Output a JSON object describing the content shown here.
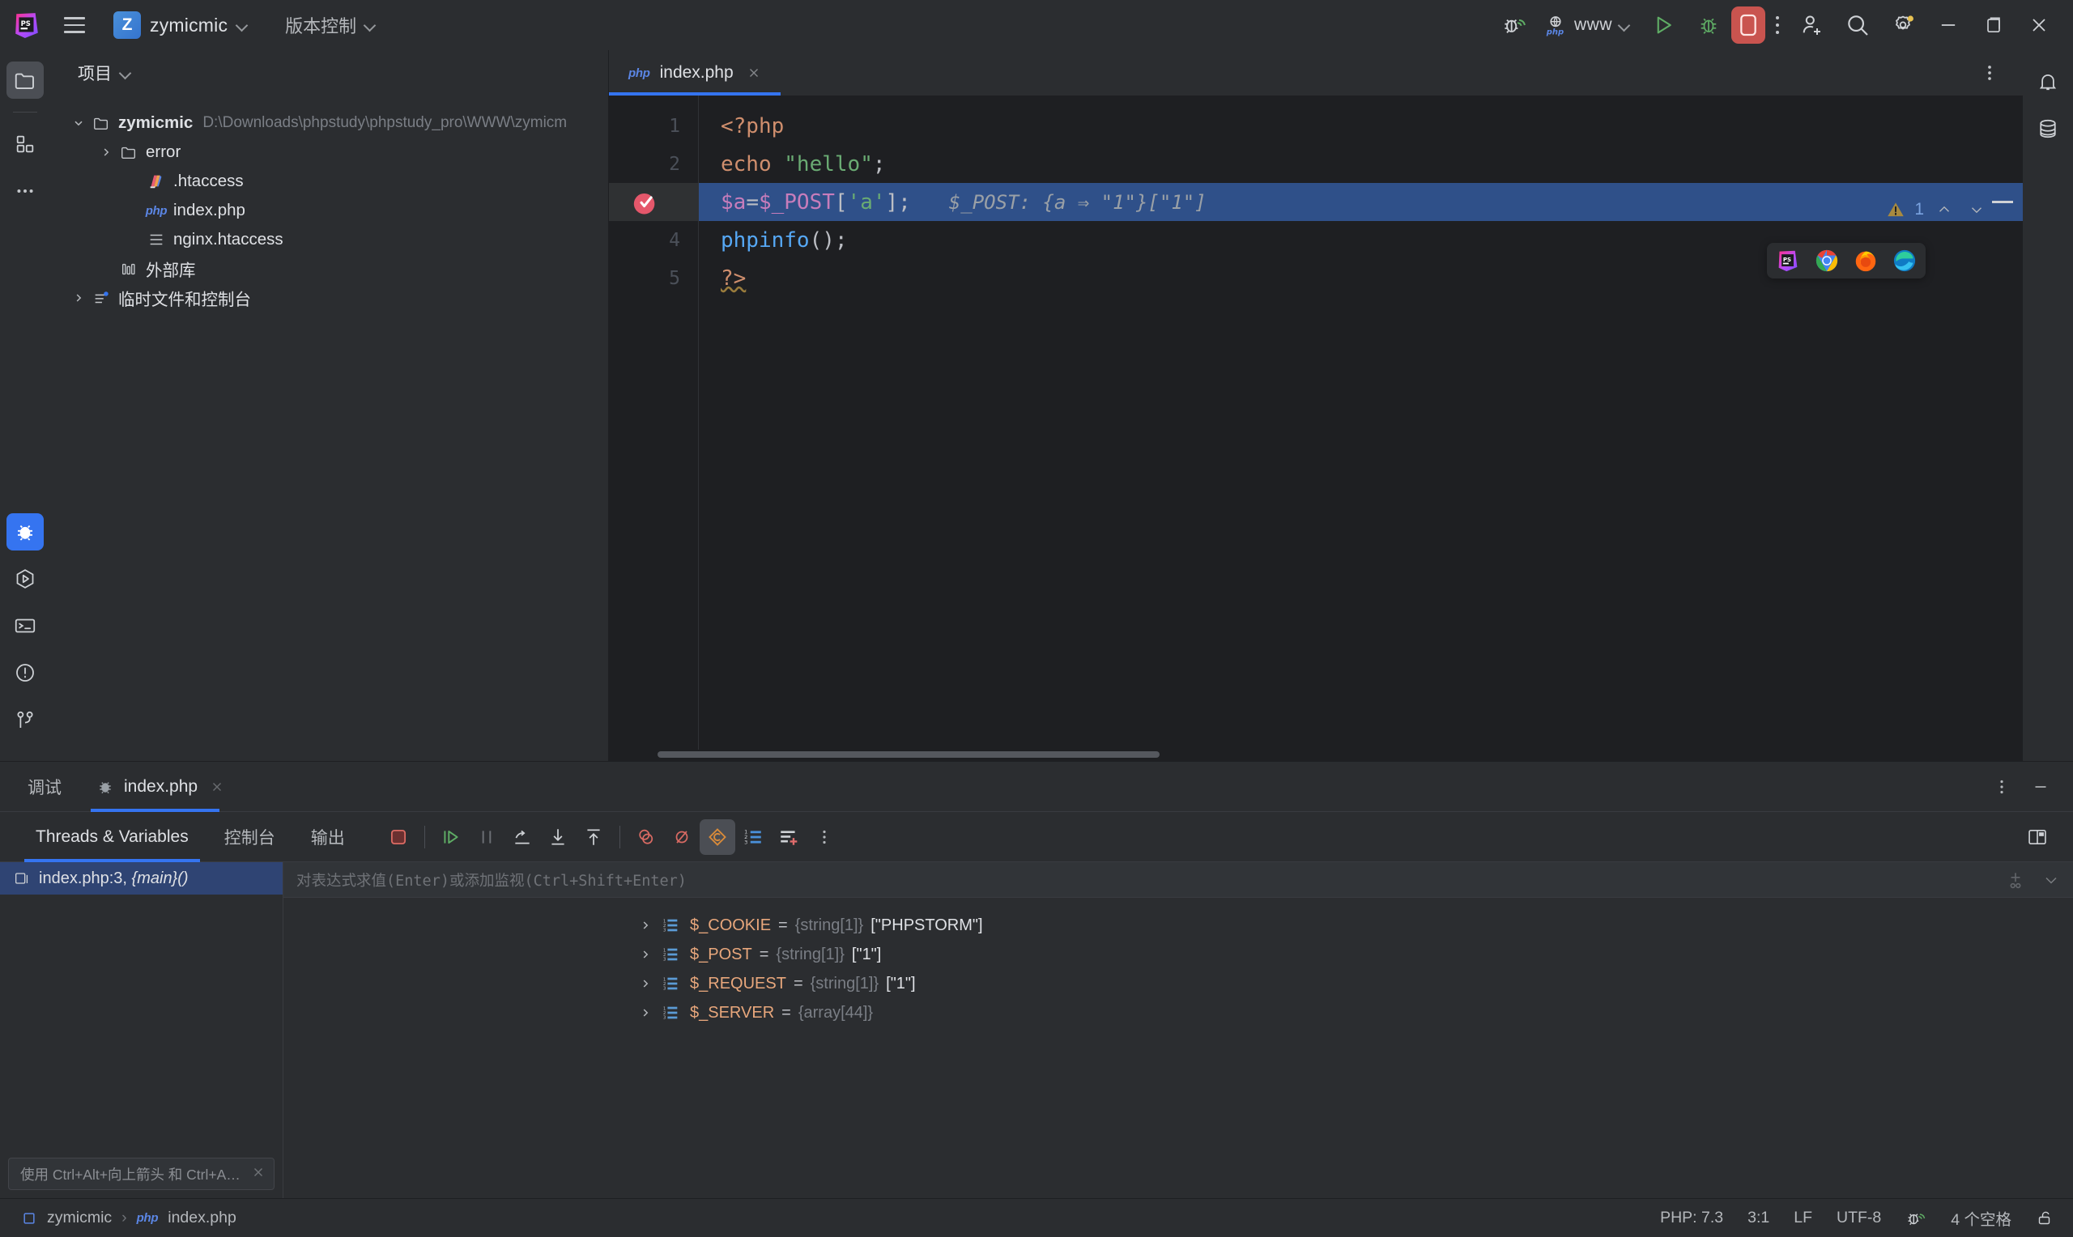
{
  "titlebar": {
    "app_icon": "phpstorm-logo-icon",
    "menu_icon": "hamburger-menu-icon",
    "project_badge": "Z",
    "project_name": "zymicmic",
    "vcs_label": "版本控制",
    "debug_listen_icon": "listen-php-debug-icon",
    "run_config": {
      "icon": "php-web-icon",
      "label": "www"
    },
    "run_icon": "run-icon",
    "debug_icon": "debug-icon",
    "stop_icon": "stop-icon",
    "more_icon": "more-vertical-icon",
    "share_icon": "add-user-icon",
    "search_icon": "search-icon",
    "settings_icon": "gear-icon",
    "minimize_icon": "minimize-icon",
    "maximize_icon": "restore-icon",
    "close_icon": "close-icon"
  },
  "rail": {
    "top": [
      {
        "name": "project",
        "icon": "folder-icon",
        "active": true
      },
      {
        "name": "commit",
        "icon": "blocks-icon",
        "active": false
      },
      {
        "name": "more-tool-windows",
        "icon": "more-horizontal-icon",
        "active": false
      }
    ],
    "bottom": [
      {
        "name": "debug",
        "icon": "bug-icon",
        "active": true
      },
      {
        "name": "run",
        "icon": "run-hex-icon",
        "active": false
      },
      {
        "name": "terminal",
        "icon": "terminal-icon",
        "active": false
      },
      {
        "name": "problems",
        "icon": "warning-circle-icon",
        "active": false
      },
      {
        "name": "version-control",
        "icon": "git-branch-icon",
        "active": false
      }
    ]
  },
  "right_rail": [
    {
      "name": "notifications",
      "icon": "bell-icon"
    },
    {
      "name": "database",
      "icon": "database-icon"
    }
  ],
  "project": {
    "header": "项目",
    "tree": [
      {
        "indent": 0,
        "arrow": "down",
        "icon": "folder-icon",
        "label": "zymicmic",
        "bold": true,
        "path": "D:\\Downloads\\phpstudy\\phpstudy_pro\\WWW\\zymicm"
      },
      {
        "indent": 1,
        "arrow": "right",
        "icon": "folder-icon",
        "label": "error",
        "bold": false,
        "path": ""
      },
      {
        "indent": 2,
        "arrow": "none",
        "icon": "htaccess-icon",
        "label": ".htaccess",
        "bold": false,
        "path": ""
      },
      {
        "indent": 2,
        "arrow": "none",
        "icon": "php-file-icon",
        "label": "index.php",
        "bold": false,
        "path": ""
      },
      {
        "indent": 2,
        "arrow": "none",
        "icon": "text-file-icon",
        "label": "nginx.htaccess",
        "bold": false,
        "path": ""
      },
      {
        "indent": 1,
        "arrow": "none",
        "icon": "library-icon",
        "label": "外部库",
        "bold": false,
        "path": ""
      },
      {
        "indent": 0,
        "arrow": "right",
        "icon": "scratches-icon",
        "label": "临时文件和控制台",
        "bold": false,
        "path": ""
      }
    ]
  },
  "editor": {
    "tab": {
      "icon": "php-file-icon",
      "label": "index.php",
      "close_icon": "close-icon"
    },
    "tabbar_more_icon": "more-vertical-icon",
    "inspection": {
      "icon": "warning-triangle-icon",
      "count": "1",
      "up_icon": "chevron-up-icon",
      "down_icon": "chevron-down-icon"
    },
    "browsers": [
      "phpstorm-browser-icon",
      "chrome-icon",
      "firefox-icon",
      "edge-icon"
    ],
    "breakpoint_line": 3,
    "current_line": 3,
    "lines": [
      {
        "no": "1",
        "tokens": [
          {
            "t": "<?php",
            "c": "tagc"
          }
        ]
      },
      {
        "no": "2",
        "tokens": [
          {
            "t": "echo",
            "c": "kw"
          },
          {
            "t": " ",
            "c": "punct"
          },
          {
            "t": "\"hello\"",
            "c": "str"
          },
          {
            "t": ";",
            "c": "punct"
          }
        ]
      },
      {
        "no": "3",
        "tokens": [
          {
            "t": "$a",
            "c": "var"
          },
          {
            "t": "=",
            "c": "punct"
          },
          {
            "t": "$_POST",
            "c": "sup"
          },
          {
            "t": "[",
            "c": "punct"
          },
          {
            "t": "'a'",
            "c": "str"
          },
          {
            "t": "]",
            "c": "punct"
          },
          {
            "t": ";",
            "c": "punct"
          },
          {
            "t": "   ",
            "c": "punct"
          },
          {
            "t": "$_POST: {a ⇒ \"1\"}[\"1\"]",
            "c": "inlay"
          }
        ]
      },
      {
        "no": "4",
        "tokens": [
          {
            "t": "phpinfo",
            "c": "fn"
          },
          {
            "t": "();",
            "c": "punct"
          }
        ]
      },
      {
        "no": "5",
        "tokens": [
          {
            "t": "?>",
            "c": "tagc squig"
          }
        ]
      }
    ]
  },
  "debug": {
    "title": "调试",
    "session_tab": {
      "icon": "bug-icon",
      "label": "index.php",
      "close_icon": "close-icon"
    },
    "panel_more_icon": "more-vertical-icon",
    "panel_hide_icon": "minimize-icon",
    "layout_icon": "layout-settings-icon",
    "subtabs": [
      {
        "label": "Threads & Variables",
        "active": true
      },
      {
        "label": "控制台",
        "active": false
      },
      {
        "label": "输出",
        "active": false
      }
    ],
    "toolbar": [
      {
        "name": "stop-session-button",
        "icon": "stop-icon",
        "on": false
      },
      {
        "name": "resume-program-button",
        "icon": "resume-icon",
        "on": false
      },
      {
        "name": "pause-program-button",
        "icon": "pause-icon",
        "on": false
      },
      {
        "name": "step-over-button",
        "icon": "step-over-icon",
        "on": false
      },
      {
        "name": "step-into-button",
        "icon": "step-into-icon",
        "on": false
      },
      {
        "name": "step-out-button",
        "icon": "step-out-icon",
        "on": false
      },
      {
        "name": "view-breakpoints-button",
        "icon": "breakpoint-icon",
        "on": false
      },
      {
        "name": "mute-breakpoints-button",
        "icon": "mute-breakpoint-icon",
        "on": false
      },
      {
        "name": "evaluate-expression-button",
        "icon": "evaluate-icon",
        "on": true
      },
      {
        "name": "sort-values-button",
        "icon": "numbered-list-icon",
        "on": false
      },
      {
        "name": "add-watch-button",
        "icon": "add-watch-icon",
        "on": false
      },
      {
        "name": "toolbar-more-button",
        "icon": "more-vertical-icon",
        "on": false
      }
    ],
    "frames": [
      {
        "icon": "frame-icon",
        "label": "index.php:3, ",
        "italic": "{main}()",
        "selected": true
      }
    ],
    "hint": {
      "text": "使用 Ctrl+Alt+向上箭头 和 Ctrl+Alt+向...",
      "close_icon": "close-icon"
    },
    "eval": {
      "placeholder": "对表达式求值(Enter)或添加监视(Ctrl+Shift+Enter)",
      "add_icon": "add-watch-icon",
      "expand_icon": "chevron-down-icon"
    },
    "variables": [
      {
        "arrow": "right",
        "icon": "array-icon",
        "name": "$_COOKIE",
        "eq": "=",
        "type": "{string[1]}",
        "value": "[\"PHPSTORM\"]"
      },
      {
        "arrow": "right",
        "icon": "array-icon",
        "name": "$_POST",
        "eq": "=",
        "type": "{string[1]}",
        "value": "[\"1\"]"
      },
      {
        "arrow": "right",
        "icon": "array-icon",
        "name": "$_REQUEST",
        "eq": "=",
        "type": "{string[1]}",
        "value": "[\"1\"]"
      },
      {
        "arrow": "right",
        "icon": "array-icon",
        "name": "$_SERVER",
        "eq": "=",
        "type": "{array[44]}",
        "value": ""
      }
    ]
  },
  "statusbar": {
    "breadcrumb": [
      {
        "icon": "module-icon",
        "label": "zymicmic"
      },
      {
        "icon": "php-file-icon",
        "label": "index.php"
      }
    ],
    "separator": "›",
    "php_version": "PHP: 7.3",
    "caret": "3:1",
    "line_ending": "LF",
    "encoding": "UTF-8",
    "debug_listener_icon": "listen-php-debug-icon",
    "indent": "4 个空格",
    "lock_icon": "unlock-icon"
  },
  "colors": {
    "accent": "#3574f0",
    "bg": "#2b2d30",
    "editor_bg": "#1e1f22",
    "selection": "#2f5089",
    "stop_red": "#c9544f",
    "keyword": "#cf8e6d",
    "string": "#6aab73",
    "variable": "#c77dbb",
    "function": "#56a8f5",
    "var_name": "#e8a77c"
  }
}
